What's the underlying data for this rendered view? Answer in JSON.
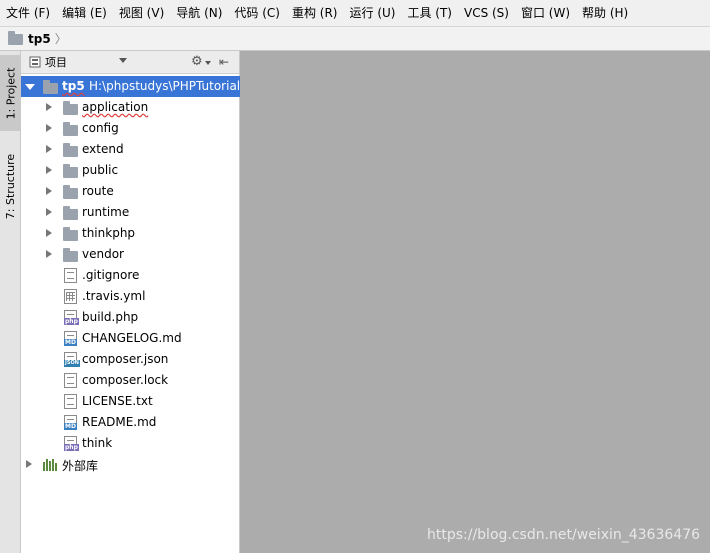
{
  "menubar": {
    "items": [
      "文件 (F)",
      "编辑 (E)",
      "视图 (V)",
      "导航 (N)",
      "代码 (C)",
      "重构 (R)",
      "运行 (U)",
      "工具 (T)",
      "VCS (S)",
      "窗口 (W)",
      "帮助 (H)"
    ]
  },
  "navbar": {
    "crumb": "tp5",
    "sep": "〉"
  },
  "tool_strip": {
    "project": "1: Project",
    "structure": "7: Structure"
  },
  "panel": {
    "view_label": "项目",
    "gear_icon": "gear-icon",
    "collapse_icon": "collapse-all-icon"
  },
  "tree": {
    "root_name": "tp5",
    "root_path": "H:\\phpstudys\\PHPTutorial",
    "folders": [
      "application",
      "config",
      "extend",
      "public",
      "route",
      "runtime",
      "thinkphp",
      "vendor"
    ],
    "files": [
      ".gitignore",
      ".travis.yml",
      "build.php",
      "CHANGELOG.md",
      "composer.json",
      "composer.lock",
      "LICENSE.txt",
      "README.md",
      "think"
    ],
    "external": "外部库"
  },
  "watermark": "https://blog.csdn.net/weixin_43636476",
  "colors": {
    "selection": "#3875d7",
    "editor_bg": "#acacac"
  }
}
